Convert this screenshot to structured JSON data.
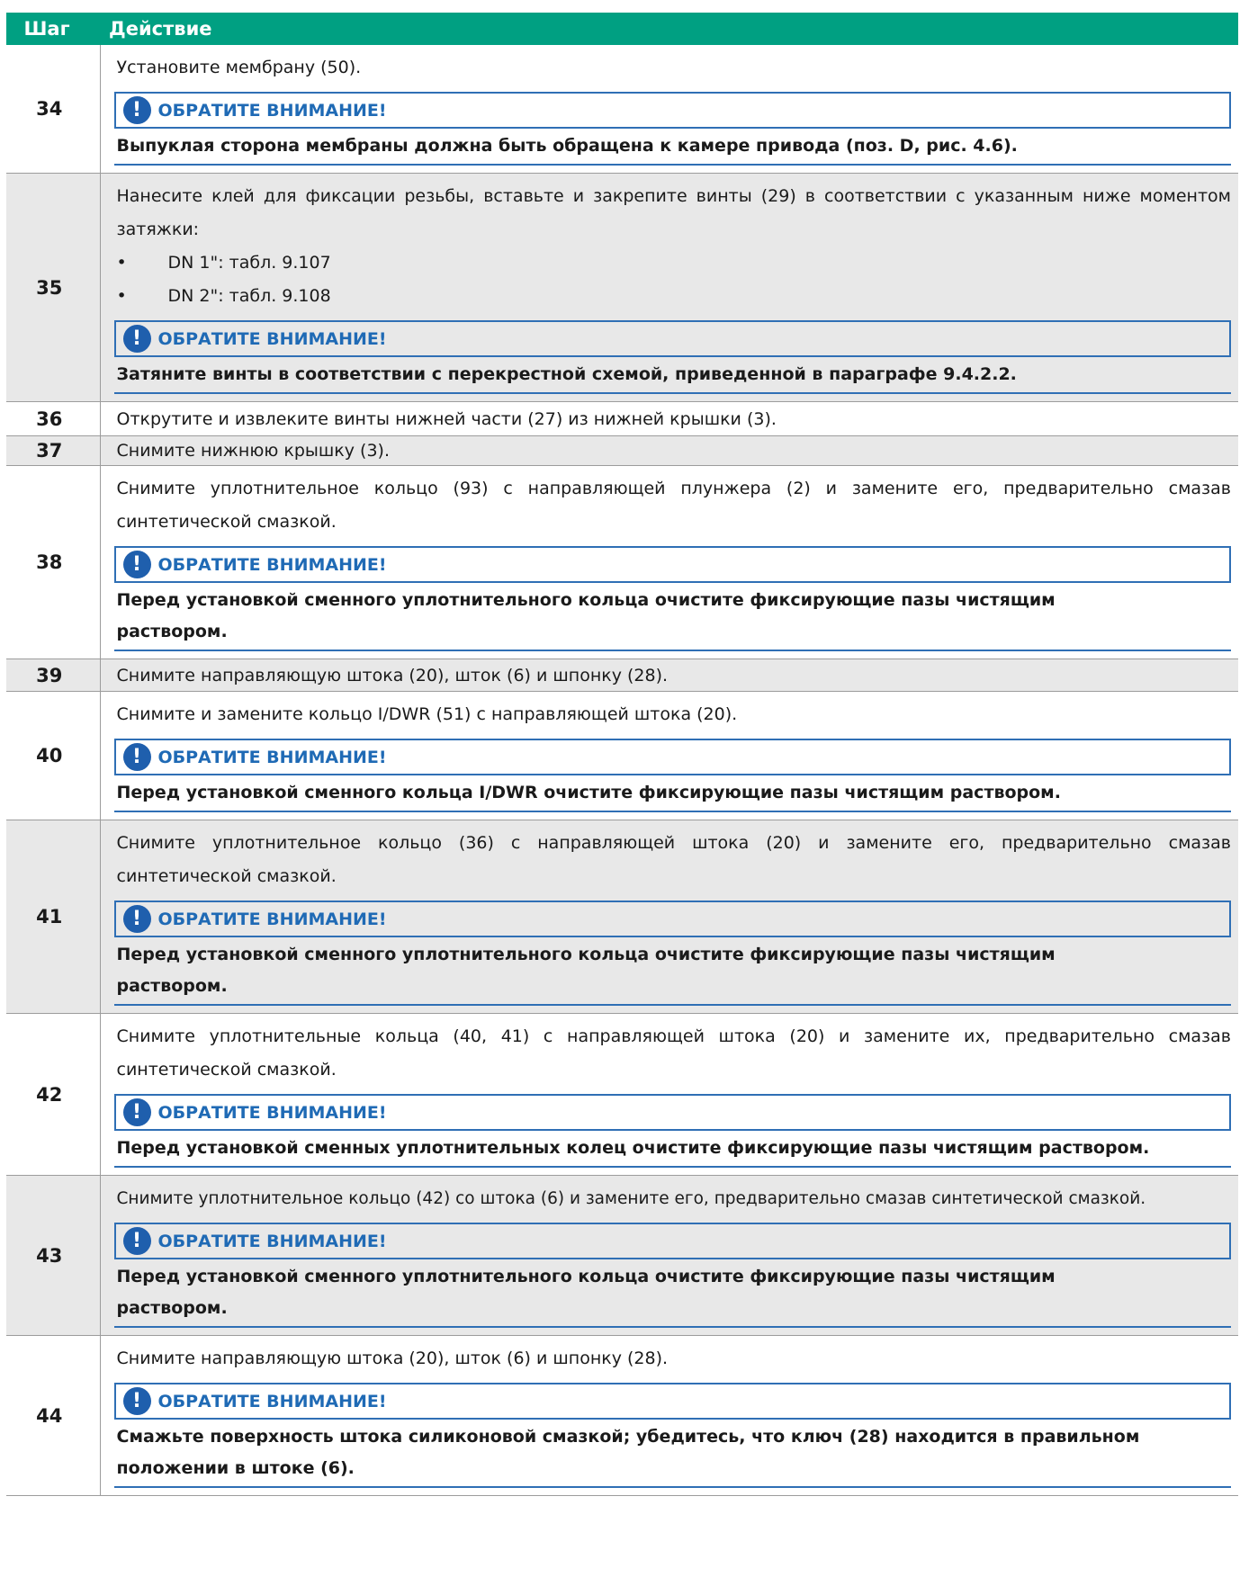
{
  "header": {
    "step": "Шаг",
    "action": "Действие"
  },
  "notice_icon": "exclamation-circle-icon",
  "colors": {
    "header_bg": "#00a082",
    "notice_border": "#2f6fb5",
    "notice_title": "#1f6ab5",
    "row_shade": "#e8e8e8"
  },
  "rows": [
    {
      "step": "34",
      "text": "Установите мембрану (50).",
      "notice_title": "ОБРАТИТЕ ВНИМАНИЕ!",
      "notice_text": "Выпуклая сторона мембраны должна быть обращена к камере привода (поз. D, рис. 4.6)."
    },
    {
      "step": "35",
      "text": "Нанесите клей для фиксации резьбы, вставьте и закрепите винты (29) в соответствии с указанным ниже моментом затяжки:",
      "bullets": [
        "DN 1\": табл. 9.107",
        "DN 2\": табл. 9.108"
      ],
      "notice_title": "ОБРАТИТЕ ВНИМАНИЕ!",
      "notice_text": "Затяните винты в соответствии с перекрестной схемой, приведенной в параграфе 9.4.2.2."
    },
    {
      "step": "36",
      "text": "Открутите и извлеките винты нижней части (27) из нижней крышки (3)."
    },
    {
      "step": "37",
      "text": "Снимите нижнюю крышку (3)."
    },
    {
      "step": "38",
      "text": "Снимите уплотнительное кольцо (93) с направляющей плунжера (2) и замените его, предварительно смазав синтетической смазкой.",
      "notice_title": "ОБРАТИТЕ ВНИМАНИЕ!",
      "notice_text": "Перед установкой сменного уплотнительного кольца очистите фиксирующие пазы чистящим раствором."
    },
    {
      "step": "39",
      "text": "Снимите направляющую штока (20), шток (6) и шпонку (28)."
    },
    {
      "step": "40",
      "text": "Снимите и замените кольцо I/DWR (51) с направляющей штока (20).",
      "notice_title": "ОБРАТИТЕ ВНИМАНИЕ!",
      "notice_text": "Перед установкой сменного кольца I/DWR очистите фиксирующие пазы чистящим раствором."
    },
    {
      "step": "41",
      "text": "Снимите уплотнительное кольцо (36) с направляющей штока (20) и замените его, предварительно смазав синтетической смазкой.",
      "notice_title": "ОБРАТИТЕ ВНИМАНИЕ!",
      "notice_text": "Перед установкой сменного уплотнительного кольца очистите фиксирующие пазы чистящим раствором."
    },
    {
      "step": "42",
      "text": "Снимите уплотнительные кольца (40, 41) с направляющей штока (20) и замените их, предварительно смазав синтетической смазкой.",
      "notice_title": "ОБРАТИТЕ ВНИМАНИЕ!",
      "notice_text": "Перед установкой сменных уплотнительных колец очистите фиксирующие пазы чистящим раствором."
    },
    {
      "step": "43",
      "text": "Снимите уплотнительное кольцо (42) со штока (6) и замените его, предварительно смазав синтетической смазкой.",
      "notice_title": "ОБРАТИТЕ ВНИМАНИЕ!",
      "notice_text": "Перед установкой сменного уплотнительного кольца очистите фиксирующие пазы чистящим раствором."
    },
    {
      "step": "44",
      "text": "Снимите направляющую штока (20), шток (6) и шпонку (28).",
      "notice_title": "ОБРАТИТЕ ВНИМАНИЕ!",
      "notice_text": "Смажьте поверхность штока силиконовой смазкой; убедитесь, что ключ (28) находится в правильном положении в штоке (6)."
    }
  ]
}
